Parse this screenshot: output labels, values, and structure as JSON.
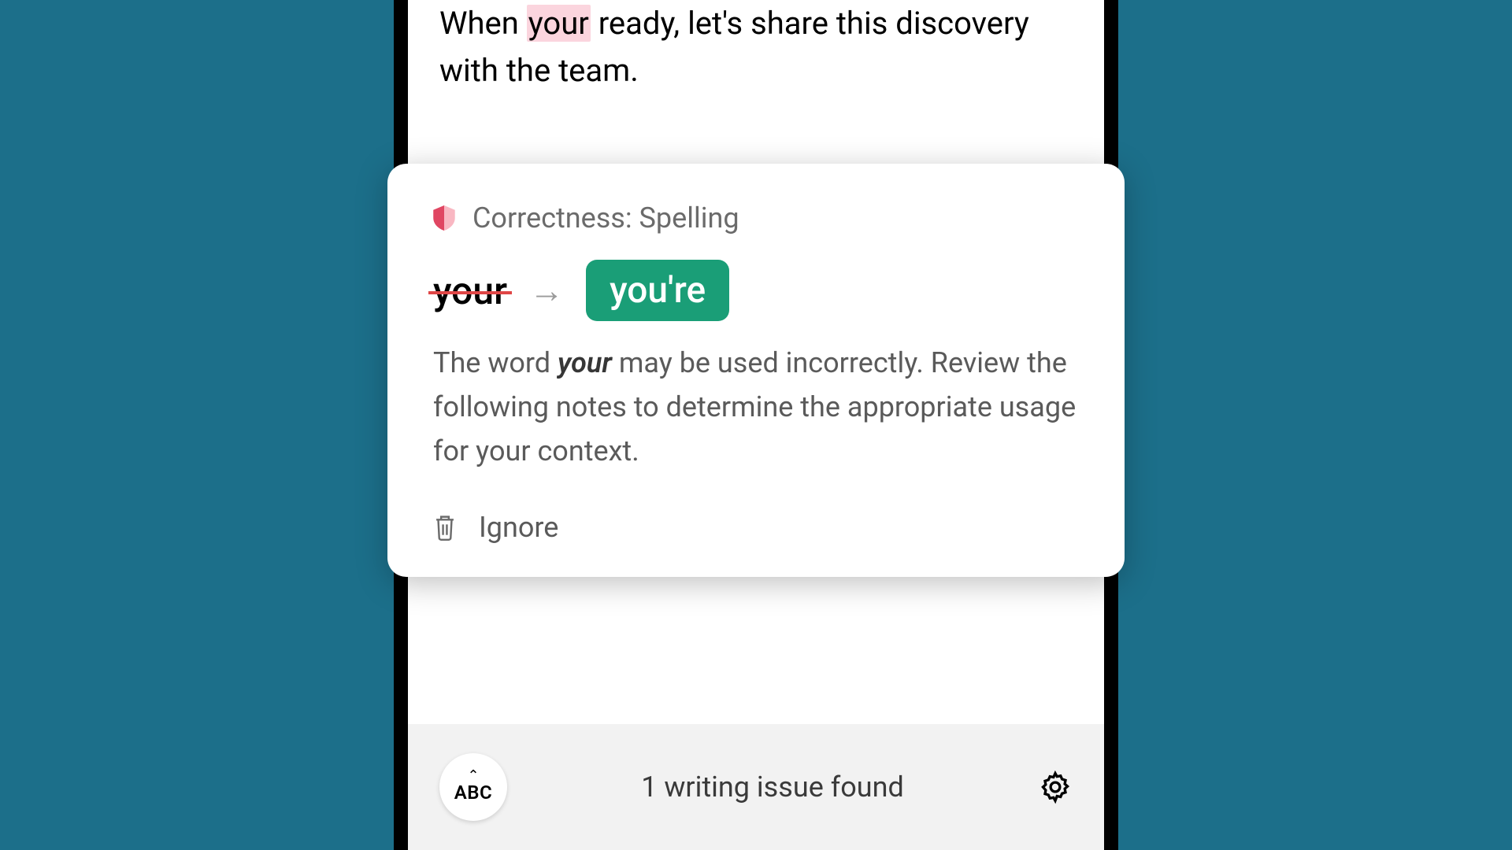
{
  "text": {
    "before": "When ",
    "highlighted": "your",
    "after": " ready, let's share this discovery with the team."
  },
  "card": {
    "header": "Correctness: Spelling",
    "original": "your",
    "suggestion": "you're",
    "explanation_prefix": "The word ",
    "explanation_word": "your",
    "explanation_suffix": " may be used incorrectly. Review the following notes to determine the appropriate usage for your context.",
    "ignore_label": "Ignore"
  },
  "bottom": {
    "keyboard_label": "ABC",
    "issue_text": "1 writing issue found"
  }
}
